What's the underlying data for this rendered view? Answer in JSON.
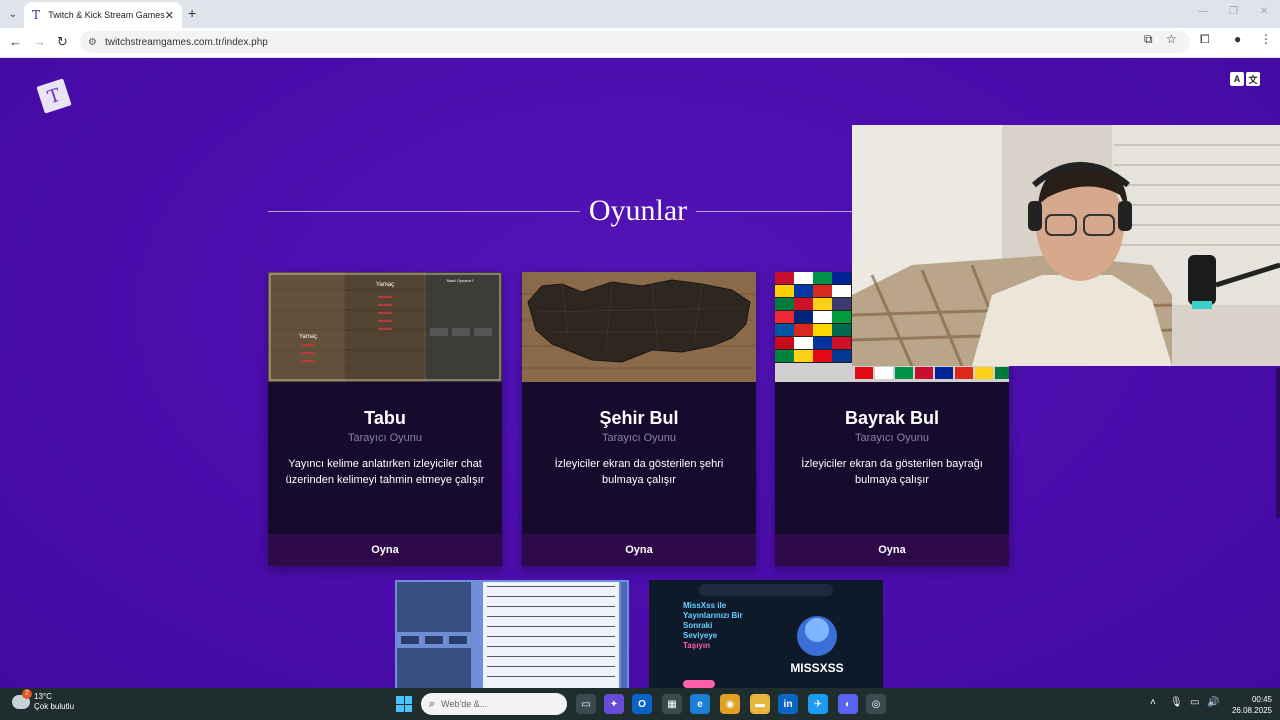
{
  "browser": {
    "tab_title": "Twitch & Kick Stream Games",
    "tab_favicon": "T",
    "url": "twitchstreamgames.com.tr/index.php"
  },
  "page": {
    "logo_letter": "T",
    "lang_icon_a": "A",
    "lang_icon_b": "文",
    "section_title": "Oyunlar",
    "games": [
      {
        "name": "Tabu",
        "subtitle": "Tarayıcı Oyunu",
        "description": "Yayıncı kelime anlatırken izleyiciler chat üzerinden kelimeyi tahmin etmeye çalışır",
        "play_label": "Oyna"
      },
      {
        "name": "Şehir Bul",
        "subtitle": "Tarayıcı Oyunu",
        "description": "İzleyiciler ekran da gösterilen şehri bulmaya çalışır",
        "play_label": "Oyna"
      },
      {
        "name": "Bayrak Bul",
        "subtitle": "Tarayıcı Oyunu",
        "description": "İzleyiciler ekran da gösterilen bayrağı bulmaya çalışır",
        "play_label": "Oyna"
      }
    ],
    "tabu_preview": {
      "word_top": "Yamaç",
      "word_left": "Yamaç",
      "panel_title": "Nasıl Oynanır?"
    },
    "missxss_preview": {
      "headline": "MissXss ile Yayınlarınızı Bir Sonraki Seviyeye Taşıyın",
      "brand": "MISSXSS"
    }
  },
  "taskbar": {
    "temperature": "13°C",
    "weather": "Çok bulutlu",
    "weather_badge": "2",
    "search_placeholder": "Web'de &...",
    "time": "00:45",
    "date": "26.08.2025"
  },
  "colors": {
    "page_bg": "#4a0cab",
    "card_bg": "#160a2d",
    "card_button": "#2e0a4a",
    "taskbar": "#1f2d2e"
  }
}
